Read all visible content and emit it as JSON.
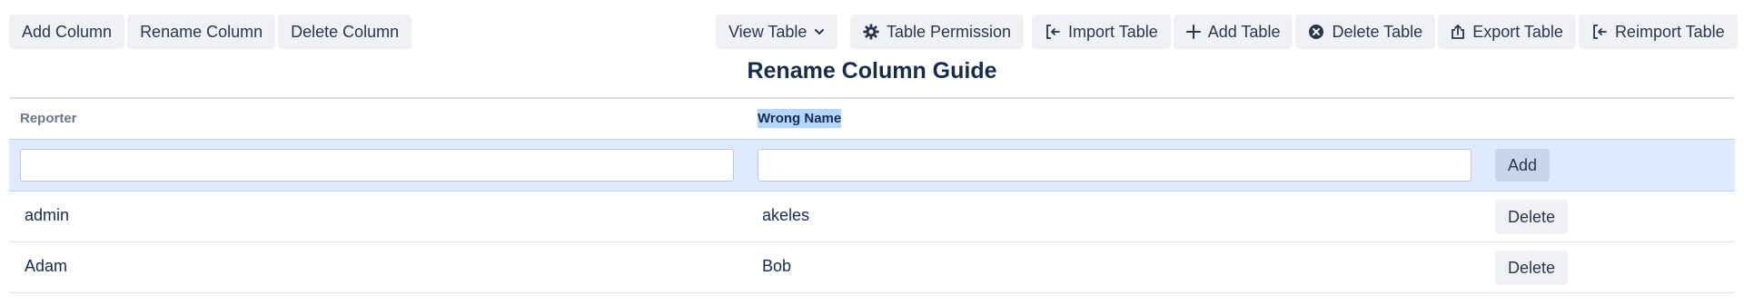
{
  "toolbar": {
    "left_buttons": [
      "Add Column",
      "Rename Column",
      "Delete Column"
    ],
    "view_table": {
      "label": "View Table",
      "icon": "chevron-down-icon"
    },
    "table_permission": {
      "label": "Table Permission",
      "icon": "gear-icon"
    },
    "right_buttons": [
      {
        "label": "Import Table",
        "icon": "import-icon"
      },
      {
        "label": "Add Table",
        "icon": "plus-icon"
      },
      {
        "label": "Delete Table",
        "icon": "close-circle-icon"
      },
      {
        "label": "Export Table",
        "icon": "export-icon"
      },
      {
        "label": "Reimport Table",
        "icon": "import-icon"
      }
    ]
  },
  "page": {
    "title": "Rename Column Guide"
  },
  "table": {
    "columns": [
      "Reporter",
      "Wrong Name"
    ],
    "new_row": {
      "reporter_value": "",
      "wrong_name_value": "",
      "add_label": "Add"
    },
    "rows": [
      {
        "reporter": "admin",
        "wrong_name": "akeles",
        "action": "Delete"
      },
      {
        "reporter": "Adam",
        "wrong_name": "Bob",
        "action": "Delete"
      }
    ]
  },
  "colors": {
    "button_bg": "#f0f1f4",
    "input_row_bg": "#deebff",
    "selection_highlight": "#b4d5fe",
    "text": "#172b4d",
    "header_muted": "#6b778c"
  }
}
